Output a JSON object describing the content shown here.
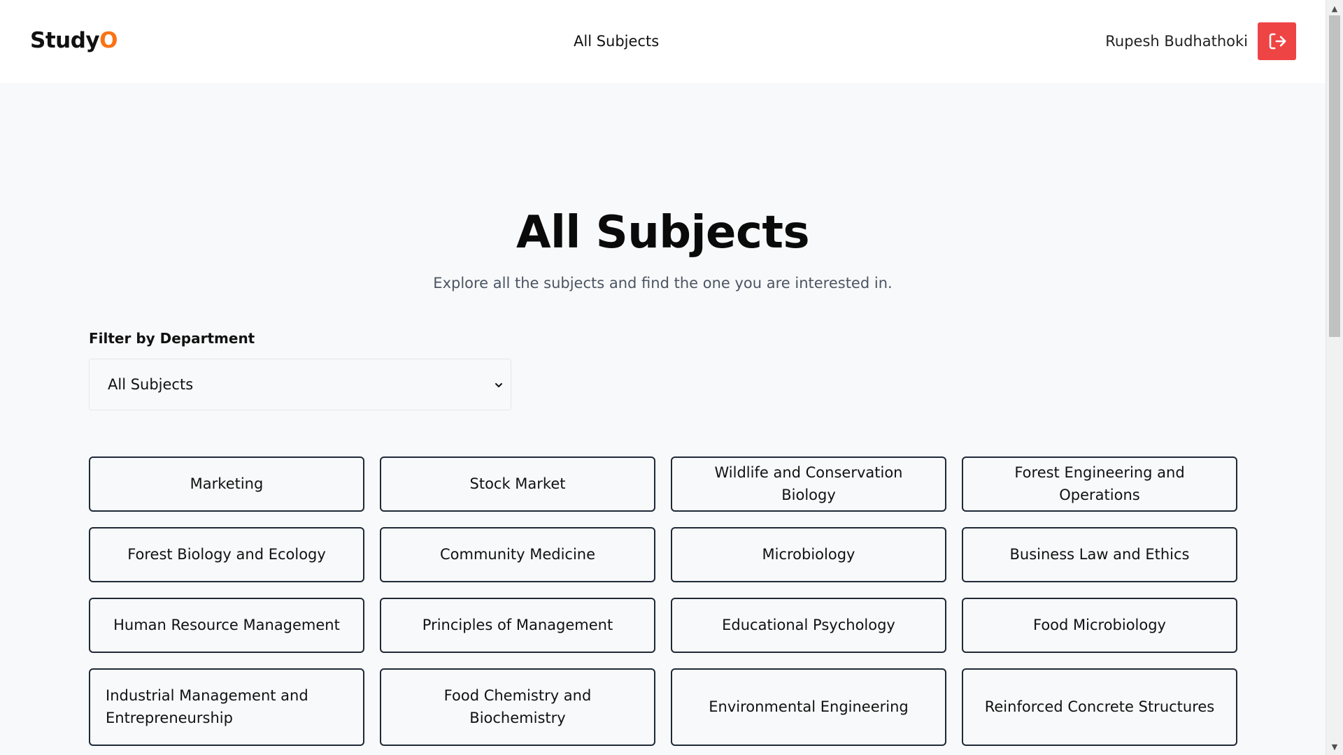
{
  "header": {
    "logo_text": "Study",
    "logo_accent": "O",
    "nav_link": "All Subjects",
    "user_name": "Rupesh Budhathoki",
    "logout_icon": "logout-icon"
  },
  "hero": {
    "title": "All Subjects",
    "subtitle": "Explore all the subjects and find the one you are interested in."
  },
  "filter": {
    "label": "Filter by Department",
    "selected": "All Subjects"
  },
  "subjects": [
    "Marketing",
    "Stock Market",
    "Wildlife and Conservation Biology",
    "Forest Engineering and Operations",
    "Forest Biology and Ecology",
    "Community Medicine",
    "Microbiology",
    "Business Law and Ethics",
    "Human Resource Management",
    "Principles of Management",
    "Educational Psychology",
    "Food Microbiology",
    "Industrial Management and Entrepreneurship",
    "Food Chemistry and Biochemistry",
    "Environmental Engineering",
    "Reinforced Concrete Structures"
  ],
  "colors": {
    "accent": "#f97316",
    "logout_bg": "#ef4444",
    "background": "#f8f9fa"
  }
}
